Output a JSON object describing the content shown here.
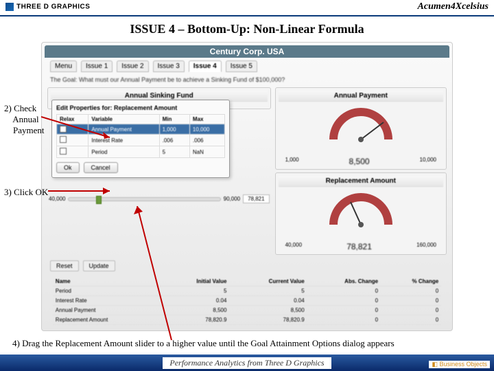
{
  "header": {
    "logo_left": "THREE D GRAPHICS",
    "logo_right": "Acumen4Xcelsius"
  },
  "title": "ISSUE 4 – Bottom-Up: Non-Linear Formula",
  "app": {
    "title": "Century Corp. USA",
    "menu_label": "Menu",
    "tabs": [
      "Issue 1",
      "Issue 2",
      "Issue 3",
      "Issue 4",
      "Issue 5"
    ],
    "active_tab": "Issue 4",
    "goal_text": "The Goal: What must our Annual Payment be to achieve a Sinking Fund of $100,000?",
    "sinking_panel_title": "Annual Sinking Fund",
    "period_label": "Period",
    "dialog": {
      "title": "Edit Properties for: Replacement Amount",
      "headers": [
        "Relax",
        "Variable",
        "Min",
        "Max"
      ],
      "rows": [
        {
          "relax": "✓",
          "var": "Annual Payment",
          "min": "1,000",
          "max": "10,000",
          "selected": true
        },
        {
          "relax": "",
          "var": "Interest Rate",
          "min": ".006",
          "max": ".006",
          "selected": false
        },
        {
          "relax": "",
          "var": "Period",
          "min": "5",
          "max": "NaN",
          "selected": false
        }
      ],
      "ok": "Ok",
      "cancel": "Cancel"
    },
    "slider": {
      "min": "40,000",
      "mid": "90,000",
      "value": "78,821"
    },
    "gauge1": {
      "title": "Annual Payment",
      "min": "1,000",
      "max": "10,000",
      "value": "8,500"
    },
    "gauge2": {
      "title": "Replacement Amount",
      "min": "40,000",
      "max": "160,000",
      "value": "78,821"
    },
    "buttons": {
      "reset": "Reset",
      "update": "Update"
    },
    "summary": {
      "headers": [
        "Name",
        "Initial Value",
        "Current Value",
        "Abs. Change",
        "% Change"
      ],
      "rows": [
        [
          "Period",
          "5",
          "5",
          "0",
          "0"
        ],
        [
          "Interest Rate",
          "0.04",
          "0.04",
          "0",
          "0"
        ],
        [
          "Annual Payment",
          "8,500",
          "8,500",
          "0",
          "0"
        ],
        [
          "Replacement Amount",
          "78,820.9",
          "78,820.9",
          "0",
          "0"
        ]
      ]
    }
  },
  "annotations": {
    "a2": "2) Check\n    Annual\n    Payment",
    "a3": "3) Click OK",
    "a4": "4) Drag the Replacement Amount slider to a higher value until the Goal Attainment Options dialog appears"
  },
  "footer": "Performance Analytics from Three D Graphics",
  "bo_logo": "Business Objects"
}
